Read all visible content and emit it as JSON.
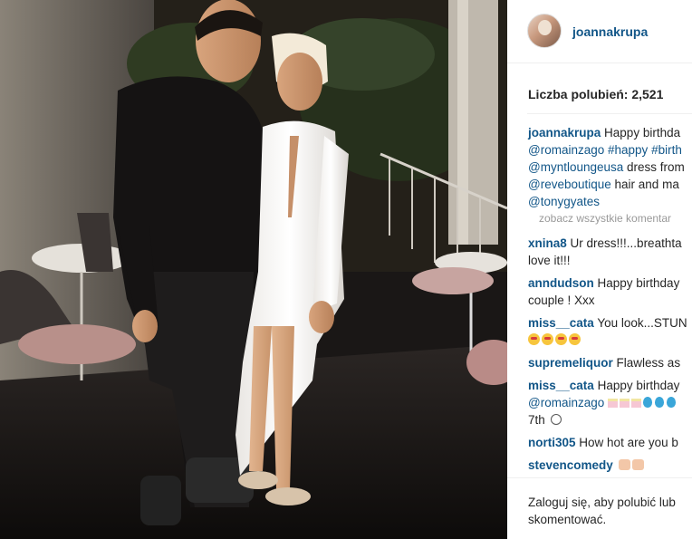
{
  "post": {
    "author": "joannakrupa",
    "likes_text": "Liczba polubień: 2,521"
  },
  "caption": {
    "user": "joannakrupa",
    "line1": "Happy birthda",
    "line2_tag1": "@romainzago",
    "line2_tag2": "#happy",
    "line2_tag3": "#birth",
    "line3_tag": "@myntloungeusa",
    "line3_text": "dress from",
    "line4_tag": "@reveboutique",
    "line4_text": "hair and ma",
    "line5_tag": "@tonygyates"
  },
  "view_all": "zobacz wszystkie komentar",
  "comments": [
    {
      "user": "xnina8",
      "text": "Ur dress!!!...breathta",
      "text2": "love it!!!"
    },
    {
      "user": "anndudson",
      "text": "Happy birthday",
      "text2": "couple ! Xxx"
    },
    {
      "user": "miss__cata",
      "text": "You look...STUN"
    },
    {
      "user": "supremeliquor",
      "text": "Flawless as"
    },
    {
      "user": "miss__cata",
      "text": "Happy birthday",
      "tag": "@romainzago",
      "text2": "7th"
    },
    {
      "user": "norti305",
      "text": "How hot are you b"
    },
    {
      "user": "stevencomedy",
      "text": ""
    }
  ],
  "login": {
    "link": "Zaloguj się",
    "text": ", aby polubić lub",
    "text2": "skomentować."
  },
  "colors": {
    "link": "#125688",
    "text": "#262626",
    "muted": "#999999",
    "divider": "#efefef"
  },
  "icons": [
    "avatar",
    "heart-eyes-emoji",
    "hands-emoji",
    "cake-emoji",
    "balloon-emoji",
    "grin-emoji"
  ]
}
